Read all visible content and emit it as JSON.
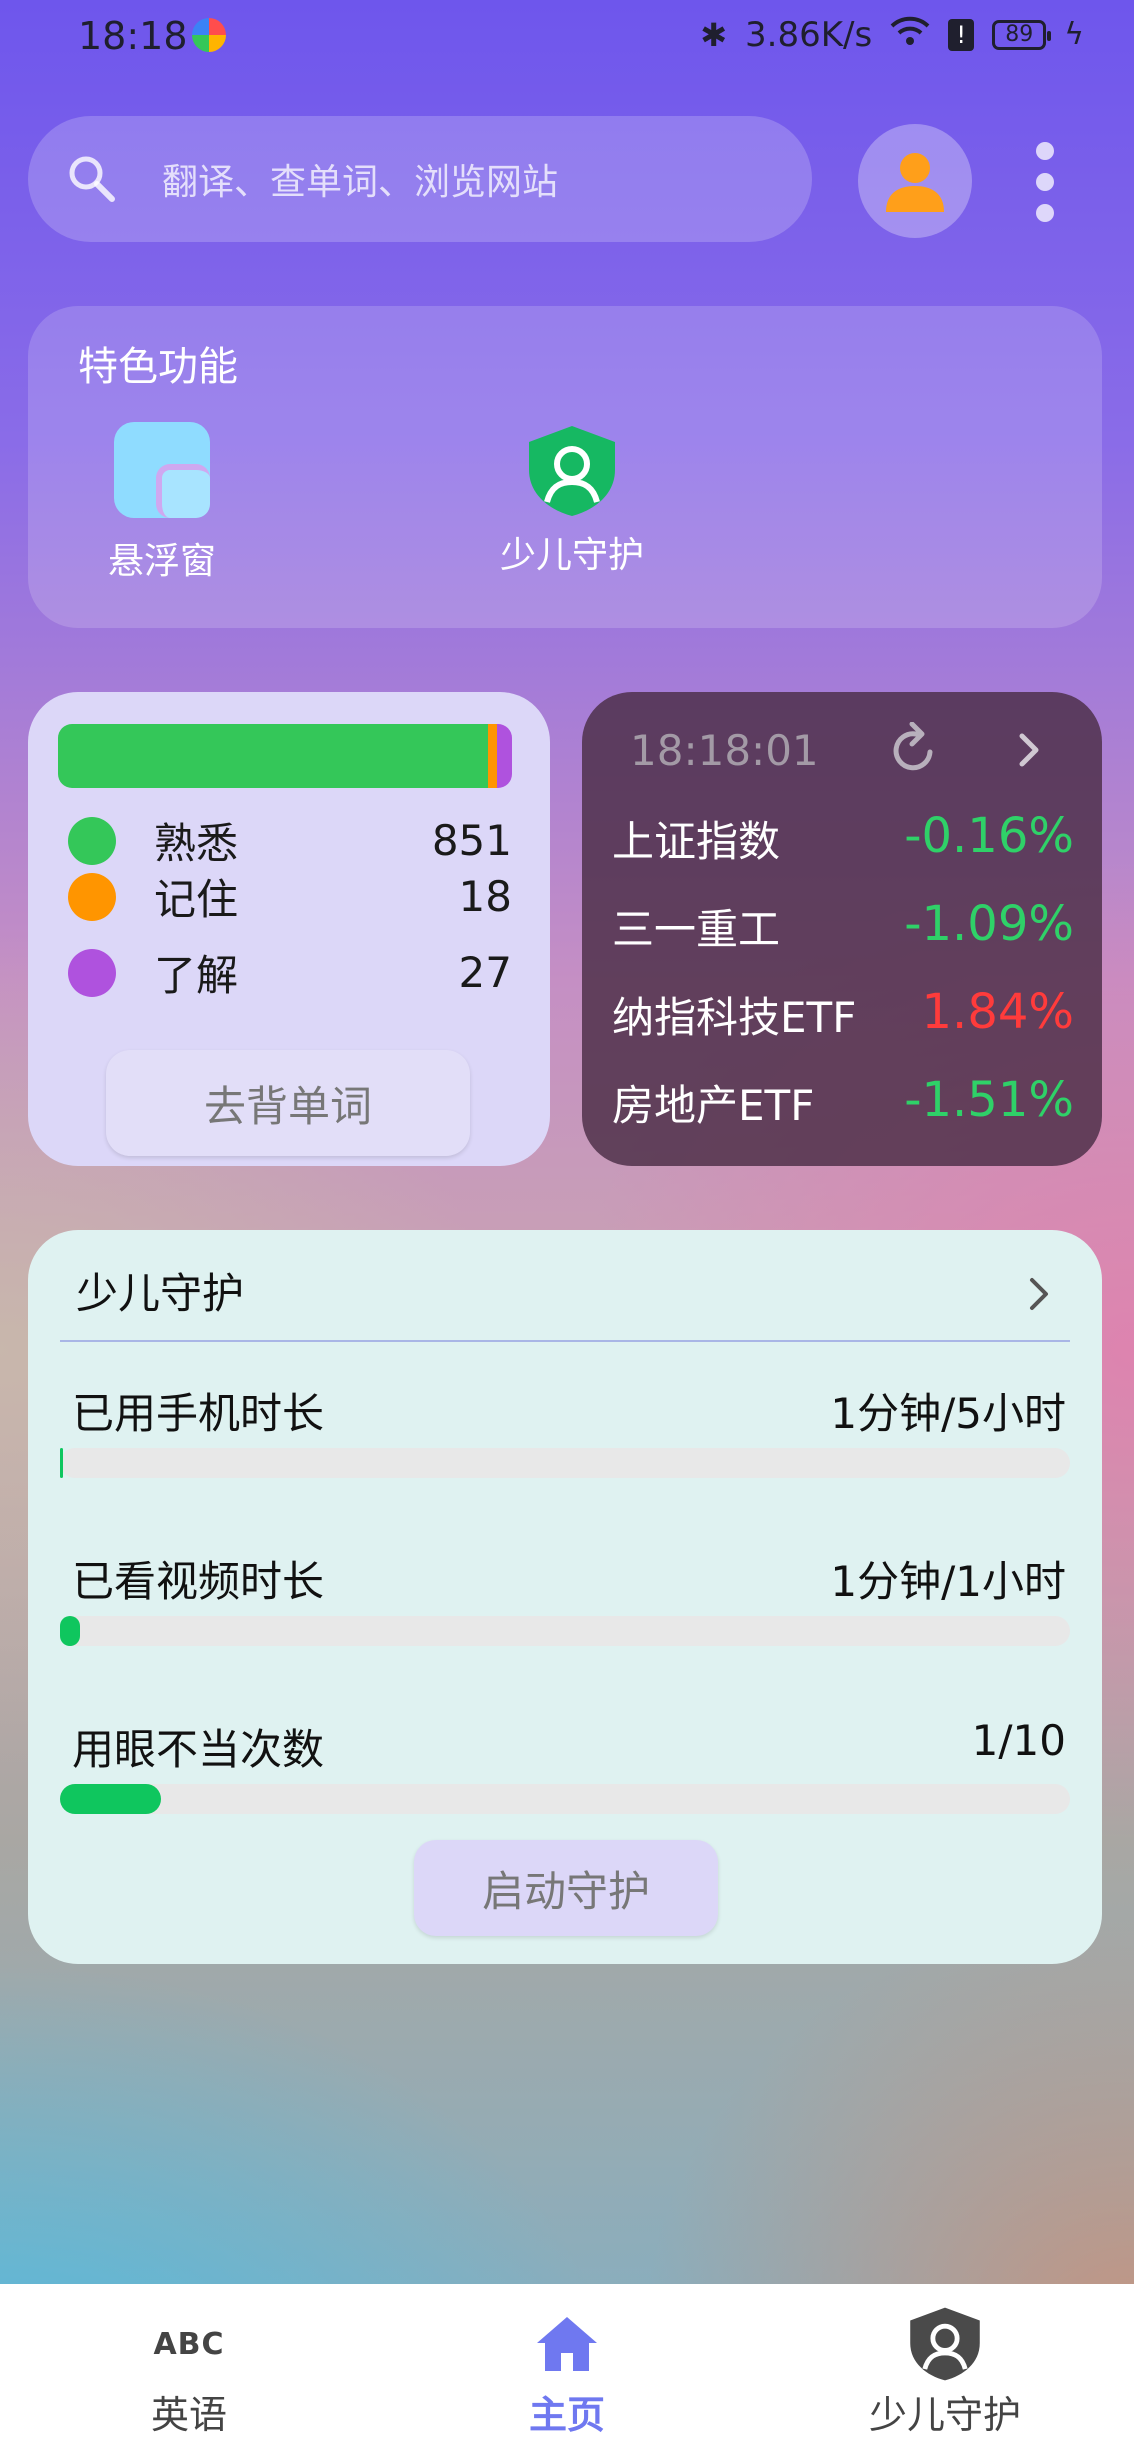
{
  "status_bar": {
    "time": "18:18",
    "speed": "3.86K/s",
    "battery": "89"
  },
  "search": {
    "placeholder": "翻译、查单词、浏览网站"
  },
  "features": {
    "title": "特色功能",
    "items": [
      {
        "label": "悬浮窗",
        "icon": "floating-window-icon"
      },
      {
        "label": "少儿守护",
        "icon": "child-shield-icon"
      }
    ]
  },
  "vocab": {
    "bar_colors": {
      "familiar": "#34c759",
      "remembered": "#ff9500",
      "understood": "#af52de"
    },
    "rows": [
      {
        "label": "熟悉",
        "count": "851",
        "color": "#34c759"
      },
      {
        "label": "记住",
        "count": "18",
        "color": "#ff9500"
      },
      {
        "label": "了解",
        "count": "27",
        "color": "#af52de"
      }
    ],
    "button": "去背单词"
  },
  "stocks": {
    "time": "18:18:01",
    "rows": [
      {
        "name": "上证指数",
        "change": "-0.16%",
        "color": "#2fd168"
      },
      {
        "name": "三一重工",
        "change": "-1.09%",
        "color": "#2fd168"
      },
      {
        "name": "纳指科技ETF",
        "change": "1.84%",
        "color": "#ff3b3b"
      },
      {
        "name": "房地产ETF",
        "change": "-1.51%",
        "color": "#2fd168"
      }
    ]
  },
  "guard": {
    "title": "少儿守护",
    "rows": [
      {
        "label": "已用手机时长",
        "value": "1分钟/5小时",
        "progress": 0.003
      },
      {
        "label": "已看视频时长",
        "value": "1分钟/1小时",
        "progress": 0.017
      },
      {
        "label": "用眼不当次数",
        "value": "1/10",
        "progress": 0.1
      }
    ],
    "button": "启动守护"
  },
  "nav": {
    "items": [
      {
        "label": "英语",
        "icon": "abc-icon"
      },
      {
        "label": "主页",
        "icon": "home-icon",
        "active": true
      },
      {
        "label": "少儿守护",
        "icon": "child-shield-icon"
      }
    ]
  }
}
